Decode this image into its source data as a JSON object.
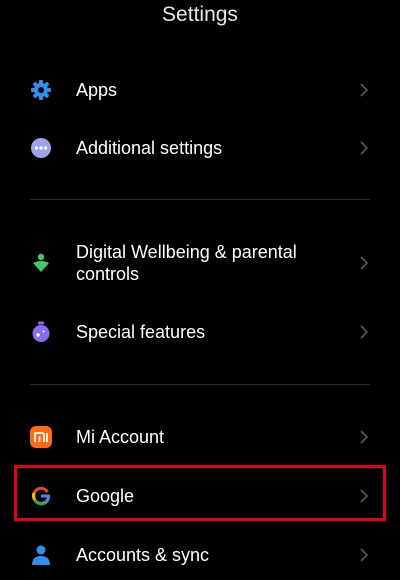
{
  "header": {
    "title": "Settings"
  },
  "items": {
    "apps": {
      "label": "Apps",
      "icon": "gear-icon"
    },
    "additional": {
      "label": "Additional settings",
      "icon": "more-dots-icon"
    },
    "wellbeing": {
      "label": "Digital Wellbeing & parental controls",
      "icon": "wellbeing-icon"
    },
    "special": {
      "label": "Special features",
      "icon": "special-features-icon"
    },
    "mi_account": {
      "label": "Mi Account",
      "icon": "mi-logo-icon"
    },
    "google": {
      "label": "Google",
      "icon": "google-logo-icon"
    },
    "accounts": {
      "label": "Accounts & sync",
      "icon": "person-icon"
    }
  },
  "colors": {
    "background": "#000000",
    "highlight": "#e2001a",
    "apps_icon": "#2f8fef",
    "additional_icon": "#9aa6e8",
    "wellbeing_icon": "#3fc76a",
    "special_icon": "#8a6cf0",
    "mi_icon": "#ff6a13",
    "accounts_icon": "#2f8fef"
  }
}
